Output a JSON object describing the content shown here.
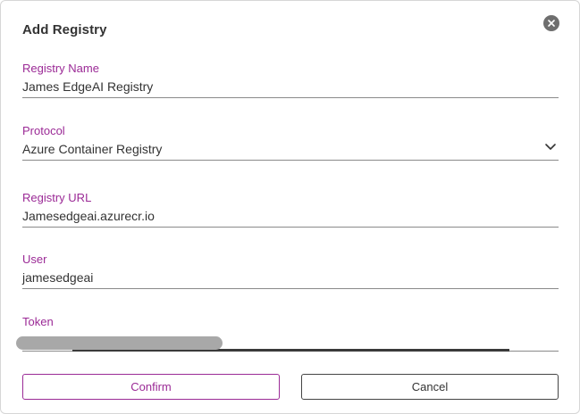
{
  "dialog": {
    "title": "Add Registry",
    "close_icon": "close-icon"
  },
  "fields": {
    "registry_name": {
      "label": "Registry Name",
      "value": "James EdgeAI Registry"
    },
    "protocol": {
      "label": "Protocol",
      "value": "Azure Container Registry",
      "icon": "chevron-down-icon"
    },
    "registry_url": {
      "label": "Registry URL",
      "value": "Jamesedgeai.azurecr.io"
    },
    "user": {
      "label": "User",
      "value": "jamesedgeai"
    },
    "token": {
      "label": "Token",
      "value": "••••••••••"
    }
  },
  "buttons": {
    "confirm": "Confirm",
    "cancel": "Cancel"
  },
  "colors": {
    "accent": "#9b2a96",
    "text": "#333333"
  }
}
